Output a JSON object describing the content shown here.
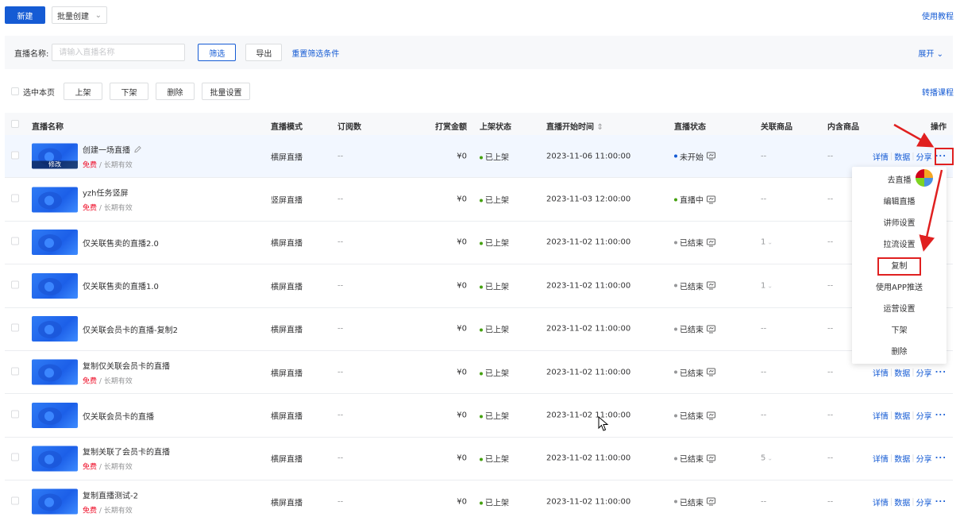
{
  "topbar": {
    "new_label": "新建",
    "batch_label": "批量创建",
    "help_label": "使用教程"
  },
  "filter": {
    "name_label": "直播名称:",
    "name_placeholder": "请输入直播名称",
    "filter_label": "筛选",
    "export_label": "导出",
    "reset_label": "重置筛选条件",
    "expand_label": "展开"
  },
  "bulk": {
    "select_page": "选中本页",
    "on_shelf": "上架",
    "off_shelf": "下架",
    "delete": "删除",
    "batch_settings": "批量设置",
    "relay_course": "转播课程"
  },
  "columns": {
    "name": "直播名称",
    "mode": "直播模式",
    "subs": "订阅数",
    "amount": "打赏金额",
    "shelf": "上架状态",
    "start_time": "直播开始时间",
    "status": "直播状态",
    "related": "关联商品",
    "included": "内含商品",
    "ops": "操作"
  },
  "rows": [
    {
      "title": "创建一场直播",
      "free": "免费",
      "validity": "/ 长期有效",
      "edit_label": "修改",
      "mode": "横屏直播",
      "subs": "--",
      "amount": "¥0",
      "shelf": "已上架",
      "time": "2023-11-06 11:00:00",
      "status": "未开始",
      "related": "--",
      "included": "--"
    },
    {
      "title": "yzh任务竖屏",
      "free": "免费",
      "validity": "/ 长期有效",
      "mode": "竖屏直播",
      "subs": "--",
      "amount": "¥0",
      "shelf": "已上架",
      "time": "2023-11-03 12:00:00",
      "status": "直播中",
      "related": "--",
      "included": "--"
    },
    {
      "title": "仅关联售卖的直播2.0",
      "mode": "横屏直播",
      "subs": "--",
      "amount": "¥0",
      "shelf": "已上架",
      "time": "2023-11-02 11:00:00",
      "status": "已结束",
      "related": "1",
      "included": "--"
    },
    {
      "title": "仅关联售卖的直播1.0",
      "mode": "横屏直播",
      "subs": "--",
      "amount": "¥0",
      "shelf": "已上架",
      "time": "2023-11-02 11:00:00",
      "status": "已结束",
      "related": "1",
      "included": "--"
    },
    {
      "title": "仅关联会员卡的直播-复制2",
      "mode": "横屏直播",
      "subs": "--",
      "amount": "¥0",
      "shelf": "已上架",
      "time": "2023-11-02 11:00:00",
      "status": "已结束",
      "related": "--",
      "included": "--"
    },
    {
      "title": "复制仅关联会员卡的直播",
      "free": "免费",
      "validity": "/ 长期有效",
      "mode": "横屏直播",
      "subs": "--",
      "amount": "¥0",
      "shelf": "已上架",
      "time": "2023-11-02 11:00:00",
      "status": "已结束",
      "related": "--",
      "included": "--"
    },
    {
      "title": "仅关联会员卡的直播",
      "mode": "横屏直播",
      "subs": "--",
      "amount": "¥0",
      "shelf": "已上架",
      "time": "2023-11-02 11:00:00",
      "status": "已结束",
      "related": "--",
      "included": "--"
    },
    {
      "title": "复制关联了会员卡的直播",
      "free": "免费",
      "validity": "/ 长期有效",
      "mode": "横屏直播",
      "subs": "--",
      "amount": "¥0",
      "shelf": "已上架",
      "time": "2023-11-02 11:00:00",
      "status": "已结束",
      "related": "5",
      "included": "--"
    },
    {
      "title": "复制直播测试-2",
      "free": "免费",
      "validity": "/ 长期有效",
      "mode": "横屏直播",
      "subs": "--",
      "amount": "¥0",
      "shelf": "已上架",
      "time": "2023-11-02 11:00:00",
      "status": "已结束",
      "related": "--",
      "included": "--"
    }
  ],
  "ops": {
    "detail": "详情",
    "data": "数据",
    "share": "分享",
    "more": "···"
  },
  "menu": {
    "items": [
      "去直播",
      "编辑直播",
      "讲师设置",
      "拉流设置",
      "复制",
      "使用APP推送",
      "运营设置",
      "下架",
      "删除"
    ],
    "highlighted": "复制"
  },
  "colors": {
    "primary": "#155bd4",
    "highlight": "#e02020",
    "free": "#ee0a24",
    "live": "#45a110"
  }
}
